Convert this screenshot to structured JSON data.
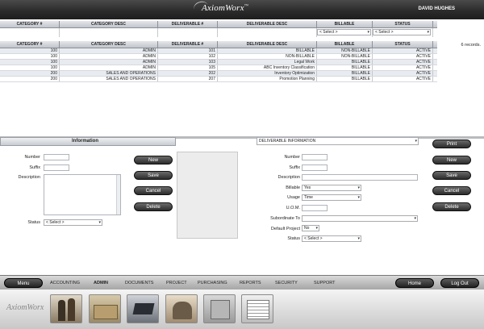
{
  "app": {
    "logo": "AxiomWorx",
    "logo_mark": "™",
    "user": "DAVID HUGHES"
  },
  "filter_table": {
    "headers": [
      "CATEGORY #",
      "CATEGORY DESC",
      "DELIVERABLE #",
      "DELIVERABLE DESC",
      "BILLABLE",
      "STATUS"
    ],
    "billable_select": "< Select >",
    "status_select": "< Select >"
  },
  "results_table": {
    "headers": [
      "CATEGORY #",
      "CATEGORY DESC",
      "DELIVERABLE #",
      "DELIVERABLE DESC",
      "BILLABLE",
      "STATUS"
    ],
    "records_label": "6 records.",
    "rows": [
      [
        "100",
        "ADMIN",
        "101",
        "BILLABLE",
        "NON-BILLABLE",
        "ACTIVE"
      ],
      [
        "100",
        "ADMIN",
        "102",
        "NON-BILLABLE",
        "NON-BILLABLE",
        "ACTIVE"
      ],
      [
        "100",
        "ADMIN",
        "103",
        "Legal Work",
        "BILLABLE",
        "ACTIVE"
      ],
      [
        "100",
        "ADMIN",
        "105",
        "ABC Inventory Classification",
        "BILLABLE",
        "ACTIVE"
      ],
      [
        "200",
        "SALES AND OPERATIONS",
        "202",
        "Inventory Optimization",
        "BILLABLE",
        "ACTIVE"
      ],
      [
        "200",
        "SALES AND OPERATIONS",
        "207",
        "Promotion Planning",
        "BILLABLE",
        "ACTIVE"
      ]
    ]
  },
  "left_panel": {
    "title": "Information",
    "number_label": "Number",
    "suffix_label": "Suffix",
    "description_label": "Description",
    "status_label": "Status",
    "status_value": "< Select >",
    "buttons": {
      "new": "New",
      "save": "Save",
      "cancel": "Cancel",
      "delete": "Delete"
    }
  },
  "right_panel": {
    "dropdown_value": "DELIVERABLE INFORMATION",
    "print": "Print",
    "number_label": "Number",
    "suffix_label": "Suffix",
    "description_label": "Description",
    "billable_label": "Billable",
    "billable_value": "Yes",
    "usage_label": "Usage",
    "usage_value": "Time",
    "uom_label": "U.O.M.",
    "subordinate_label": "Subordinate To",
    "default_project_label": "Default Project",
    "default_project_value": "No",
    "status_label": "Status",
    "status_value": "< Select >",
    "buttons": {
      "new": "New",
      "save": "Save",
      "cancel": "Cancel",
      "delete": "Delete"
    }
  },
  "bottom_nav": {
    "menu": "Menu",
    "items": [
      "ACCOUNTING",
      "ADMIN",
      "DOCUMENTS",
      "PROJECT",
      "PURCHASING",
      "REPORTS",
      "SECURITY",
      "SUPPORT"
    ],
    "active": "ADMIN",
    "home": "Home",
    "logout": "Log Out"
  },
  "icon_bar": {
    "logo": "AxiomWorx",
    "icons": [
      "people-icon",
      "folders-icon",
      "laptop-icon",
      "team-icon",
      "safe-icon",
      "newspaper-icon"
    ]
  }
}
